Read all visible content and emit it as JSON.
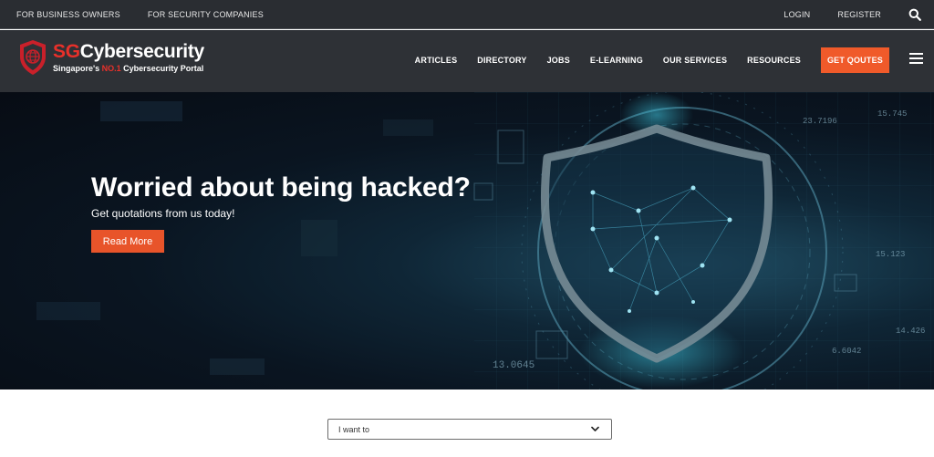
{
  "topbar": {
    "links": [
      "FOR BUSINESS OWNERS",
      "FOR SECURITY COMPANIES"
    ],
    "login": "LOGIN",
    "register": "REGISTER",
    "search_icon": "search-icon"
  },
  "header": {
    "brand_sg": "SG",
    "brand_rest": "Cybersecurity",
    "tagline_prefix": "Singapore's ",
    "tagline_highlight": "NO.1",
    "tagline_suffix": " Cybersecurity Portal",
    "nav": [
      "ARTICLES",
      "DIRECTORY",
      "JOBS",
      "E-LEARNING",
      "OUR SERVICES",
      "RESOURCES"
    ],
    "cta": "GET QOUTES",
    "menu_icon": "hamburger-menu-icon"
  },
  "hero": {
    "title": "Worried about being hacked?",
    "subtitle": "Get quotations from us today!",
    "button": "Read More",
    "overlay_numbers": [
      "23.7196",
      "15.745",
      "13.0645",
      "14.426",
      "6.6042",
      "15.123"
    ]
  },
  "select": {
    "value": "I want to"
  },
  "colors": {
    "accent": "#f05a2a",
    "brand_red": "#e8302a",
    "topbar_bg": "#2a2d32",
    "header_bg": "#2e3136"
  }
}
